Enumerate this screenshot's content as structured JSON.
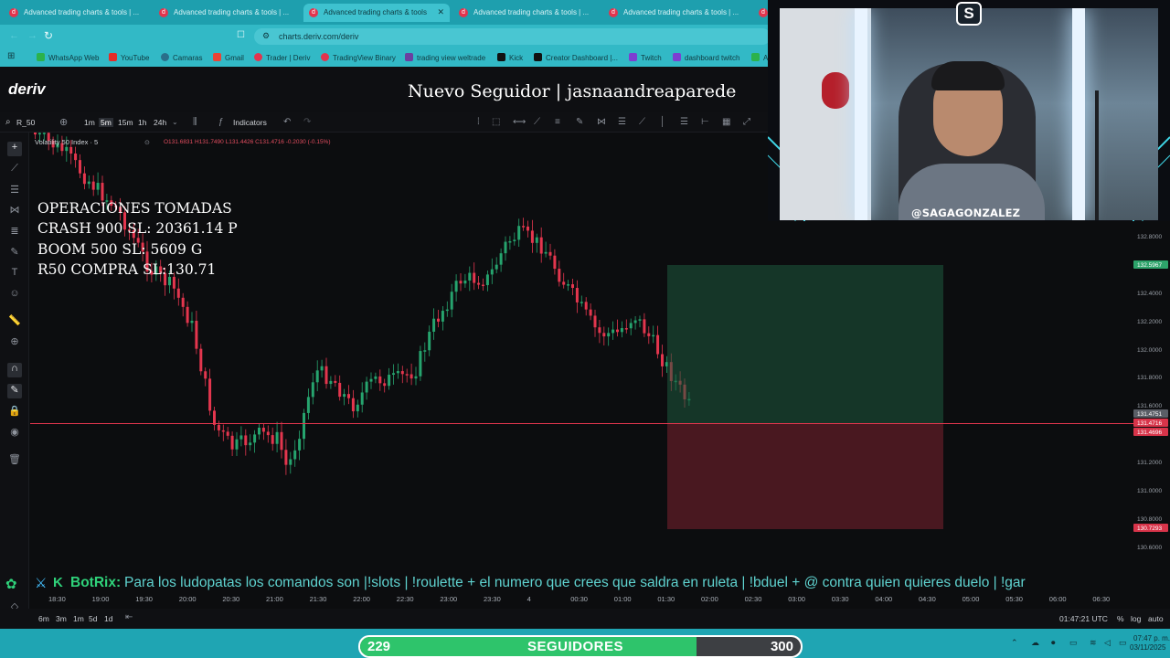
{
  "browser": {
    "tabs": [
      {
        "label": "Advanced trading charts & tools | ...",
        "active": false
      },
      {
        "label": "Advanced trading charts & tools | ...",
        "active": false
      },
      {
        "label": "Advanced trading charts & tools",
        "active": true
      },
      {
        "label": "Advanced trading charts & tools | ...",
        "active": false
      },
      {
        "label": "Advanced trading charts & tools | ...",
        "active": false
      },
      {
        "label": "",
        "active": false
      }
    ],
    "url": "charts.deriv.com/deriv",
    "bookmarks": [
      "WhatsApp Web",
      "YouTube",
      "Camaras",
      "Gmail",
      "Trader | Deriv",
      "TradingView Binary",
      "trading view weltrade",
      "Kick",
      "Creator Dashboard |...",
      "Twitch",
      "dashboard twitch",
      "A"
    ]
  },
  "header": {
    "logo": "deriv",
    "alert": "Nuevo Seguidor | jasnaandreaparede"
  },
  "toolbar": {
    "symbol": "R_50",
    "intervals": [
      "1m",
      "5m",
      "15m",
      "1h",
      "24h"
    ],
    "active_interval": "5m",
    "indicators_label": "Indicators"
  },
  "chart": {
    "legend": "Volatility 50 Index · 5",
    "ohlc": "O131.6831  H131.7490  L131.4426  C131.4716  -0.2030 (-0.15%)",
    "price_ticks": [
      "132.8000",
      "132.4000",
      "132.2000",
      "132.0000",
      "131.8000",
      "131.6000",
      "131.2000",
      "131.0000",
      "130.8000",
      "130.6000"
    ],
    "price_badges": [
      {
        "label": "132.5967",
        "color": "#2da36a"
      },
      {
        "label": "131.4751",
        "color": "#5a5e66"
      },
      {
        "label": "131.4716",
        "color": "#d8344a"
      },
      {
        "label": "131.4696",
        "color": "#d8344a"
      },
      {
        "label": "130.7293",
        "color": "#d8344a"
      }
    ],
    "time_ticks": [
      "18:30",
      "19:00",
      "19:30",
      "20:00",
      "20:30",
      "21:00",
      "21:30",
      "22:00",
      "22:30",
      "23:00",
      "23:30",
      "4",
      "00:30",
      "01:00",
      "01:30",
      "02:00",
      "02:30",
      "03:00",
      "03:30",
      "04:00",
      "04:30",
      "05:00",
      "05:30",
      "06:00",
      "06:30"
    ],
    "utc_time": "01:47:21 UTC",
    "ranges": [
      "6m",
      "3m",
      "1m",
      "5d",
      "1d"
    ],
    "scale_options": [
      "%",
      "log",
      "auto"
    ],
    "colors": {
      "up": "#26a46e",
      "down": "#e4364e",
      "price_line": "#e4364e"
    }
  },
  "overlay": {
    "lines": [
      "OPERACIONES TOMADAS",
      "CRASH 900 SL: 20361.14 P",
      "BOOM 500 SL: 5609 G",
      "R50 COMPRA SL:130.71"
    ]
  },
  "webcam": {
    "handle": "@SAGAGONZALEZ"
  },
  "ticker": {
    "bot": "BotRix:",
    "message": "Para los ludopatas los comandos son |!slots | !roulette + el numero que crees que saldra en ruleta | !bduel + @ contra quien quieres duelo | !gar"
  },
  "follow_goal": {
    "current": "229",
    "label": "SEGUIDORES",
    "target": "300",
    "progress": 0.763
  },
  "tray": {
    "time": "07:47 p. m.",
    "date": "03/11/2025"
  }
}
